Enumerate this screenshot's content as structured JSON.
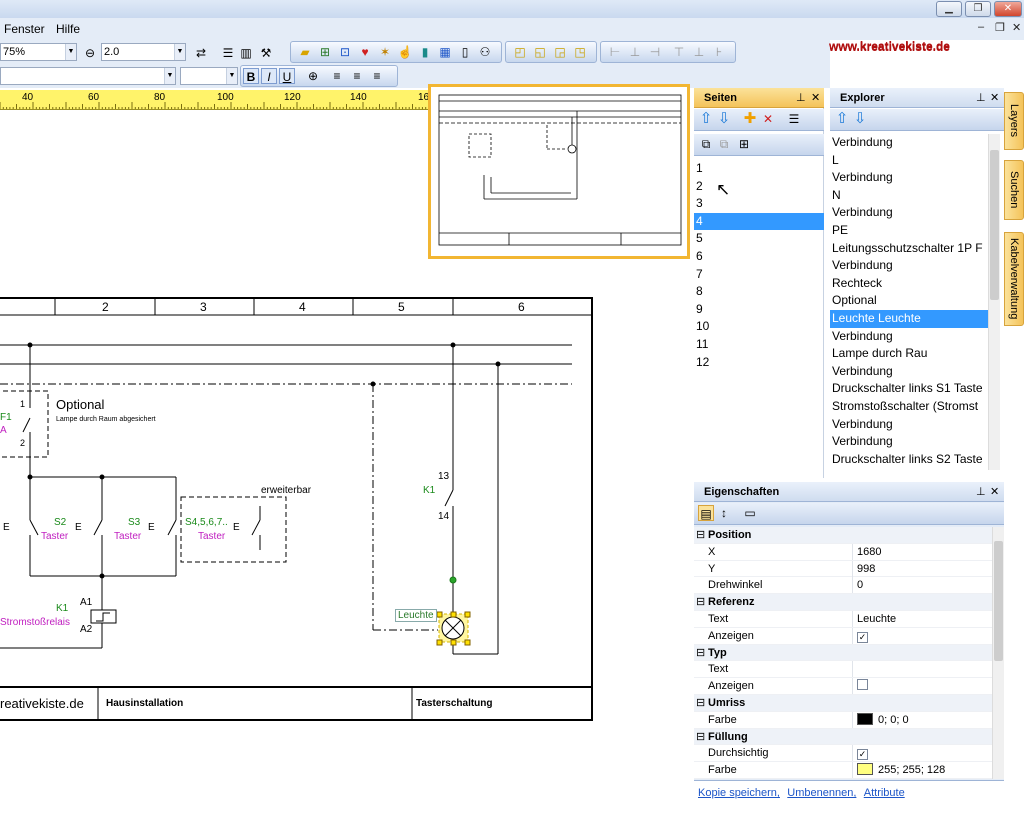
{
  "menu": {
    "fenster": "Fenster",
    "hilfe": "Hilfe"
  },
  "toolbar": {
    "zoom_value": "75%",
    "line_width": "2.0"
  },
  "watermark": "www.kreativekiste.de",
  "ruler": {
    "ticks": [
      "40",
      "60",
      "80",
      "100",
      "120",
      "140",
      "16"
    ]
  },
  "drawing": {
    "columns": [
      "2",
      "3",
      "4",
      "5",
      "6"
    ],
    "optional_title": "Optional",
    "optional_sub": "Lampe durch Raum abgesichert",
    "f1_label": "F1",
    "f1_sub": "A",
    "f1_pins": [
      "1",
      "2"
    ],
    "e_marks": [
      "E",
      "E",
      "E",
      "E"
    ],
    "s2_label": "S2",
    "s3_label": "S3",
    "s4_label": "S4,5,6,7..",
    "taster": "Taster",
    "erweiterbar": "erweiterbar",
    "k1_label": "K1",
    "k1_sub": "Stromstoßrelais",
    "a1": "A1",
    "a2": "A2",
    "k1_right_label": "K1",
    "pin13": "13",
    "pin14": "14",
    "leuchte_ref": "Leuchte",
    "footer_left": "reativekiste.de",
    "footer_mid": "Hausinstallation",
    "footer_right": "Tasterschaltung"
  },
  "seiten": {
    "title": "Seiten",
    "pages": [
      "1",
      "2",
      "3",
      "4",
      "5",
      "6",
      "7",
      "8",
      "9",
      "10",
      "11",
      "12"
    ],
    "selected": "4"
  },
  "explorer": {
    "title": "Explorer",
    "items": [
      "Verbindung",
      "L",
      "Verbindung",
      "N",
      "Verbindung",
      "PE",
      "Leitungsschutzschalter 1P F",
      "Verbindung",
      "Rechteck",
      "Optional",
      "Leuchte Leuchte",
      "Verbindung",
      "Lampe durch Rau",
      "Verbindung",
      "Druckschalter links S1 Taste",
      "Stromstoßschalter (Stromst",
      "Verbindung",
      "Verbindung",
      "Druckschalter links S2 Taste"
    ],
    "selected": "Leuchte Leuchte"
  },
  "sidetabs": [
    "Layers",
    "Suchen",
    "Kabelverwaltung"
  ],
  "eigenschaften": {
    "title": "Eigenschaften",
    "rows": [
      {
        "type": "cat",
        "key": "Position"
      },
      {
        "type": "val",
        "key": "X",
        "value": "1680"
      },
      {
        "type": "val",
        "key": "Y",
        "value": "998"
      },
      {
        "type": "val",
        "key": "Drehwinkel",
        "value": "0"
      },
      {
        "type": "cat",
        "key": "Referenz"
      },
      {
        "type": "val",
        "key": "Text",
        "value": "Leuchte"
      },
      {
        "type": "chk",
        "key": "Anzeigen",
        "checked": true
      },
      {
        "type": "cat",
        "key": "Typ"
      },
      {
        "type": "val",
        "key": "Text",
        "value": ""
      },
      {
        "type": "chk",
        "key": "Anzeigen",
        "checked": false
      },
      {
        "type": "cat",
        "key": "Umriss"
      },
      {
        "type": "color",
        "key": "Farbe",
        "value": "0; 0; 0",
        "swatch": "#000000"
      },
      {
        "type": "cat",
        "key": "Füllung"
      },
      {
        "type": "chk",
        "key": "Durchsichtig",
        "checked": true
      },
      {
        "type": "color",
        "key": "Farbe",
        "value": "255; 255; 128",
        "swatch": "#ffff80"
      }
    ],
    "links": [
      "Kopie speichern,",
      "Umbenennen,",
      "Attribute"
    ]
  },
  "colors": {
    "accent": "#f4c35a",
    "selection": "#3399ff",
    "green": "#1a8a1a",
    "magenta": "#c020c0"
  }
}
